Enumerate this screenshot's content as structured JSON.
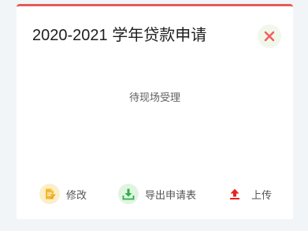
{
  "card": {
    "title": "2020-2021 学年贷款申请",
    "status": "待现场受理"
  },
  "actions": {
    "edit_label": "修改",
    "export_label": "导出申请表",
    "upload_label": "上传"
  },
  "icons": {
    "close": "close-icon",
    "edit": "document-edit-icon",
    "export": "download-icon",
    "upload": "upload-icon"
  },
  "colors": {
    "accent": "#e65a5a",
    "close_icon": "#f0615f",
    "edit_icon": "#f5b82e",
    "export_icon": "#2fb046",
    "upload_icon": "#e8231f",
    "background": "#f1f5f8"
  }
}
